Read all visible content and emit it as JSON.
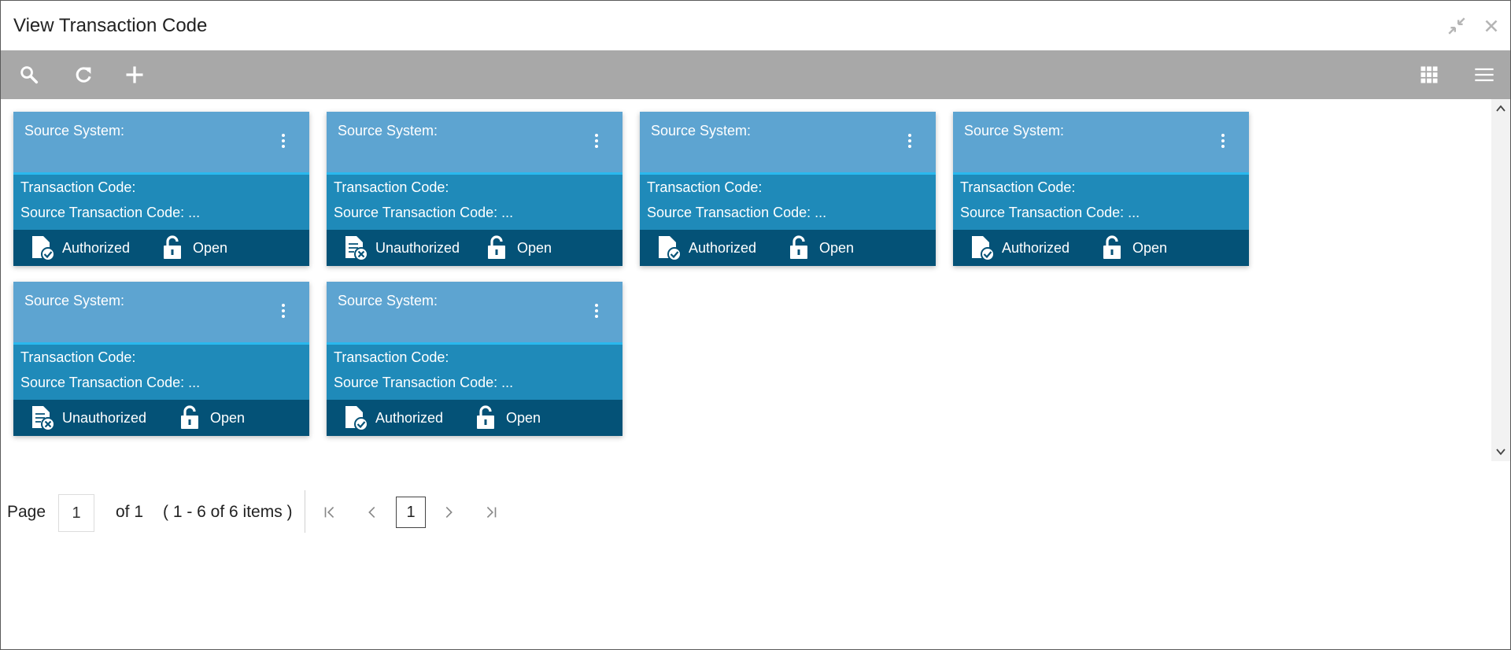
{
  "window": {
    "title": "View Transaction Code",
    "minimize_icon": "collapse-arrows-icon",
    "close_icon": "close-icon"
  },
  "toolbar": {
    "left_icons": [
      "search-icon",
      "refresh-icon",
      "add-icon"
    ],
    "right_icons": [
      "grid-view-icon",
      "list-view-icon"
    ]
  },
  "colors": {
    "toolbar_bg": "#a8a8a8",
    "card_head": "#5da4d1",
    "card_mid": "#1f8ab9",
    "card_foot": "#045277",
    "accent_line": "#2ab8ee"
  },
  "cards": [
    {
      "source_system_label": "Source System:",
      "transaction_code_label": "Transaction Code:",
      "source_transaction_code_label": "Source Transaction Code: ...",
      "auth_status": "Authorized",
      "auth_icon": "authorized-doc-icon",
      "record_status": "Open",
      "record_icon": "unlock-icon"
    },
    {
      "source_system_label": "Source System:",
      "transaction_code_label": "Transaction Code:",
      "source_transaction_code_label": "Source Transaction Code: ...",
      "auth_status": "Unauthorized",
      "auth_icon": "unauthorized-doc-icon",
      "record_status": "Open",
      "record_icon": "unlock-icon"
    },
    {
      "source_system_label": "Source System:",
      "transaction_code_label": "Transaction Code:",
      "source_transaction_code_label": "Source Transaction Code: ...",
      "auth_status": "Authorized",
      "auth_icon": "authorized-doc-icon",
      "record_status": "Open",
      "record_icon": "unlock-icon"
    },
    {
      "source_system_label": "Source System:",
      "transaction_code_label": "Transaction Code:",
      "source_transaction_code_label": "Source Transaction Code: ...",
      "auth_status": "Authorized",
      "auth_icon": "authorized-doc-icon",
      "record_status": "Open",
      "record_icon": "unlock-icon"
    },
    {
      "source_system_label": "Source System:",
      "transaction_code_label": "Transaction Code:",
      "source_transaction_code_label": "Source Transaction Code: ...",
      "auth_status": "Unauthorized",
      "auth_icon": "unauthorized-doc-icon",
      "record_status": "Open",
      "record_icon": "unlock-icon"
    },
    {
      "source_system_label": "Source System:",
      "transaction_code_label": "Transaction Code:",
      "source_transaction_code_label": "Source Transaction Code: ...",
      "auth_status": "Authorized",
      "auth_icon": "authorized-doc-icon",
      "record_status": "Open",
      "record_icon": "unlock-icon"
    }
  ],
  "pagination": {
    "page_label": "Page",
    "page_input_value": "1",
    "of_label": "of 1",
    "items_label": "( 1 - 6 of 6 items )",
    "current_page": "1",
    "icons": [
      "first-page-icon",
      "prev-page-icon",
      "next-page-icon",
      "last-page-icon"
    ]
  }
}
